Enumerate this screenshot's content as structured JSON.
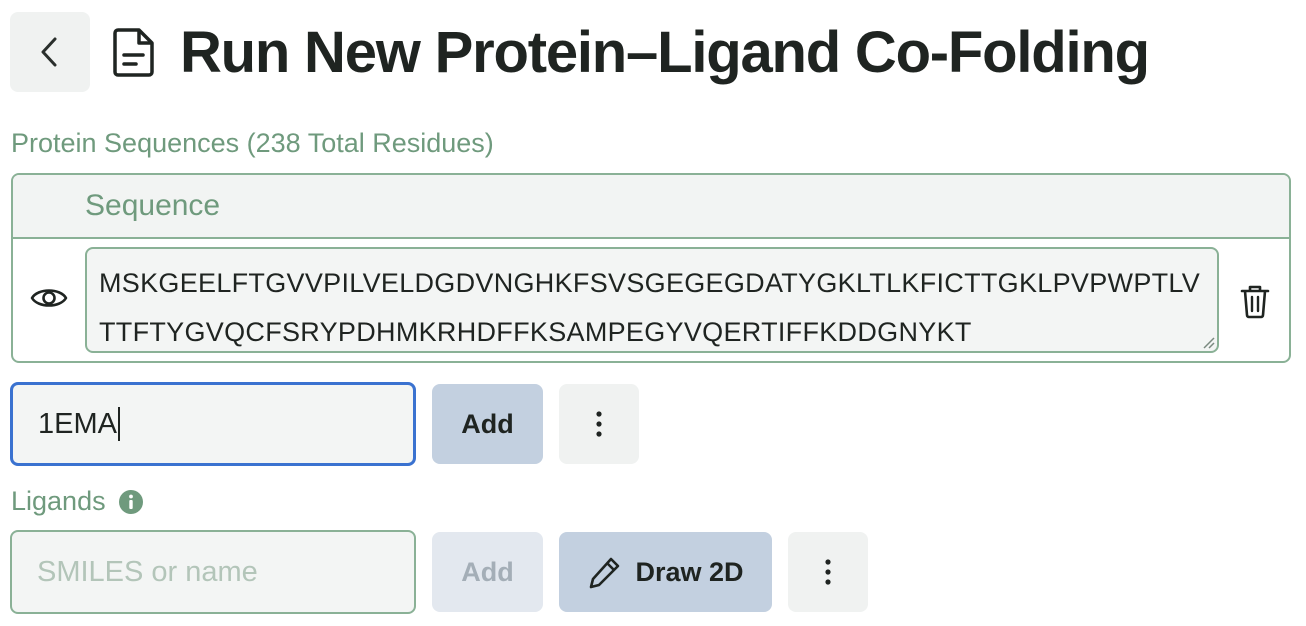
{
  "header": {
    "title": "Run New Protein–Ligand Co-Folding",
    "back_icon": "chevron-left-icon",
    "doc_icon": "document-icon"
  },
  "protein": {
    "label": "Protein Sequences (238 Total Residues)",
    "column_header": "Sequence",
    "sequence": "MSKGEELFTGVVPILVELDGDVNGHKFSVSGEGEGDATYGKLTLKFICTTGKLPVPWPTLVTTFTYGVQCFSRYPDHMKRHDFFKSAMPEGYVQERTIFFKDDGNYKT",
    "view_icon": "eye-icon",
    "delete_icon": "trash-icon",
    "pdb_input_value": "1EMA",
    "add_label": "Add",
    "more_icon": "more-vertical-icon"
  },
  "ligands": {
    "label": "Ligands",
    "info_icon": "info-icon",
    "input_placeholder": "SMILES or name",
    "add_label": "Add",
    "draw_label": "Draw 2D",
    "draw_icon": "pencil-icon",
    "more_icon": "more-vertical-icon"
  },
  "colors": {
    "accent_green": "#6f9a7d",
    "border_green": "#8ab196",
    "focus_blue": "#3a72d0",
    "button_blue": "#c3d0e0"
  }
}
